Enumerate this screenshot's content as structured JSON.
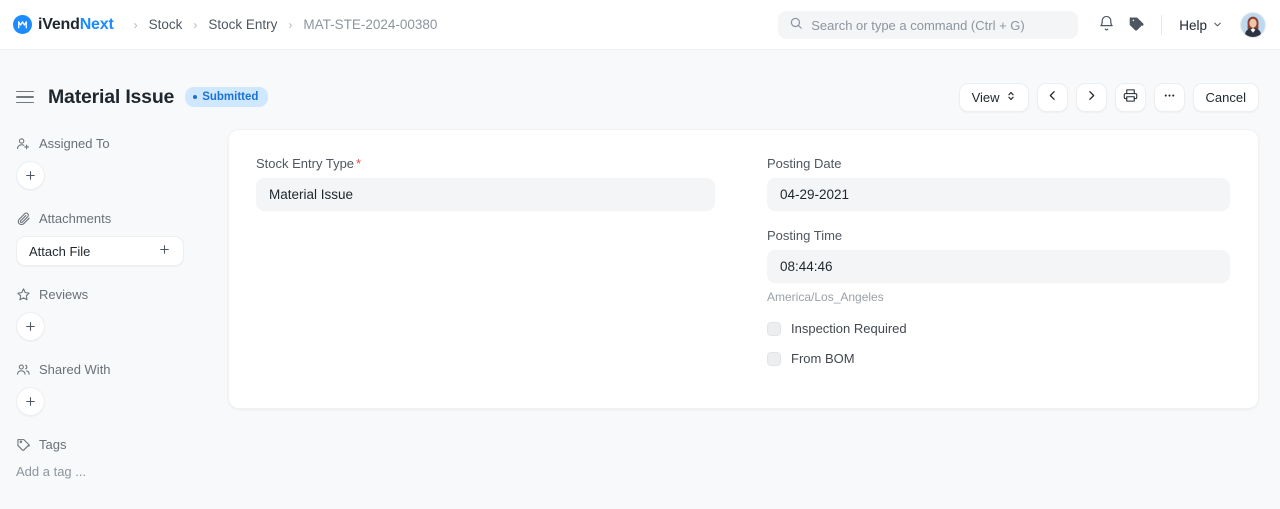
{
  "brand": {
    "name_part1": "iVend",
    "name_part2": "Next",
    "logo_icon": "ivend-logo-icon"
  },
  "breadcrumb": {
    "items": [
      {
        "label": "Stock",
        "current": false
      },
      {
        "label": "Stock Entry",
        "current": false
      },
      {
        "label": "MAT-STE-2024-00380",
        "current": true
      }
    ],
    "separator": "›"
  },
  "search": {
    "placeholder": "Search or type a command (Ctrl + G)",
    "value": "",
    "icon": "search-icon"
  },
  "navbar": {
    "notifications_icon": "bell-icon",
    "tags_icon": "tag-icon",
    "help_label": "Help",
    "help_chevron_icon": "chevron-down-icon",
    "avatar_icon": "user-avatar"
  },
  "page": {
    "menu_icon": "hamburger-menu-icon",
    "title": "Material Issue",
    "status": "Submitted"
  },
  "actions": {
    "view_label": "View",
    "view_icon": "selector-up-down-icon",
    "prev_icon": "chevron-left-icon",
    "next_icon": "chevron-right-icon",
    "print_icon": "printer-icon",
    "more_icon": "ellipsis-icon",
    "cancel_label": "Cancel"
  },
  "sidebar": {
    "sections": [
      {
        "label": "Assigned To",
        "icon": "user-plus-icon",
        "control": "plus-circle"
      },
      {
        "label": "Attachments",
        "icon": "paperclip-icon",
        "control": "attach-button",
        "button_label": "Attach File"
      },
      {
        "label": "Reviews",
        "icon": "star-icon",
        "control": "plus-circle"
      },
      {
        "label": "Shared With",
        "icon": "users-icon",
        "control": "plus-circle"
      },
      {
        "label": "Tags",
        "icon": "tag-icon",
        "control": "tag-input",
        "tag_placeholder": "Add a tag ..."
      }
    ]
  },
  "form": {
    "stock_entry_type": {
      "label": "Stock Entry Type",
      "required": true,
      "value": "Material Issue"
    },
    "posting_date": {
      "label": "Posting Date",
      "value": "04-29-2021"
    },
    "posting_time": {
      "label": "Posting Time",
      "value": "08:44:46",
      "hint": "America/Los_Angeles"
    },
    "checkboxes": [
      {
        "label": "Inspection Required",
        "checked": false
      },
      {
        "label": "From BOM",
        "checked": false
      }
    ]
  },
  "colors": {
    "accent": "#1a8cff",
    "status_bg": "#cfe7ff",
    "status_fg": "#1a72d4",
    "required": "#e24c4c",
    "page_bg": "#f8f9fa",
    "input_bg": "#f4f5f6"
  }
}
